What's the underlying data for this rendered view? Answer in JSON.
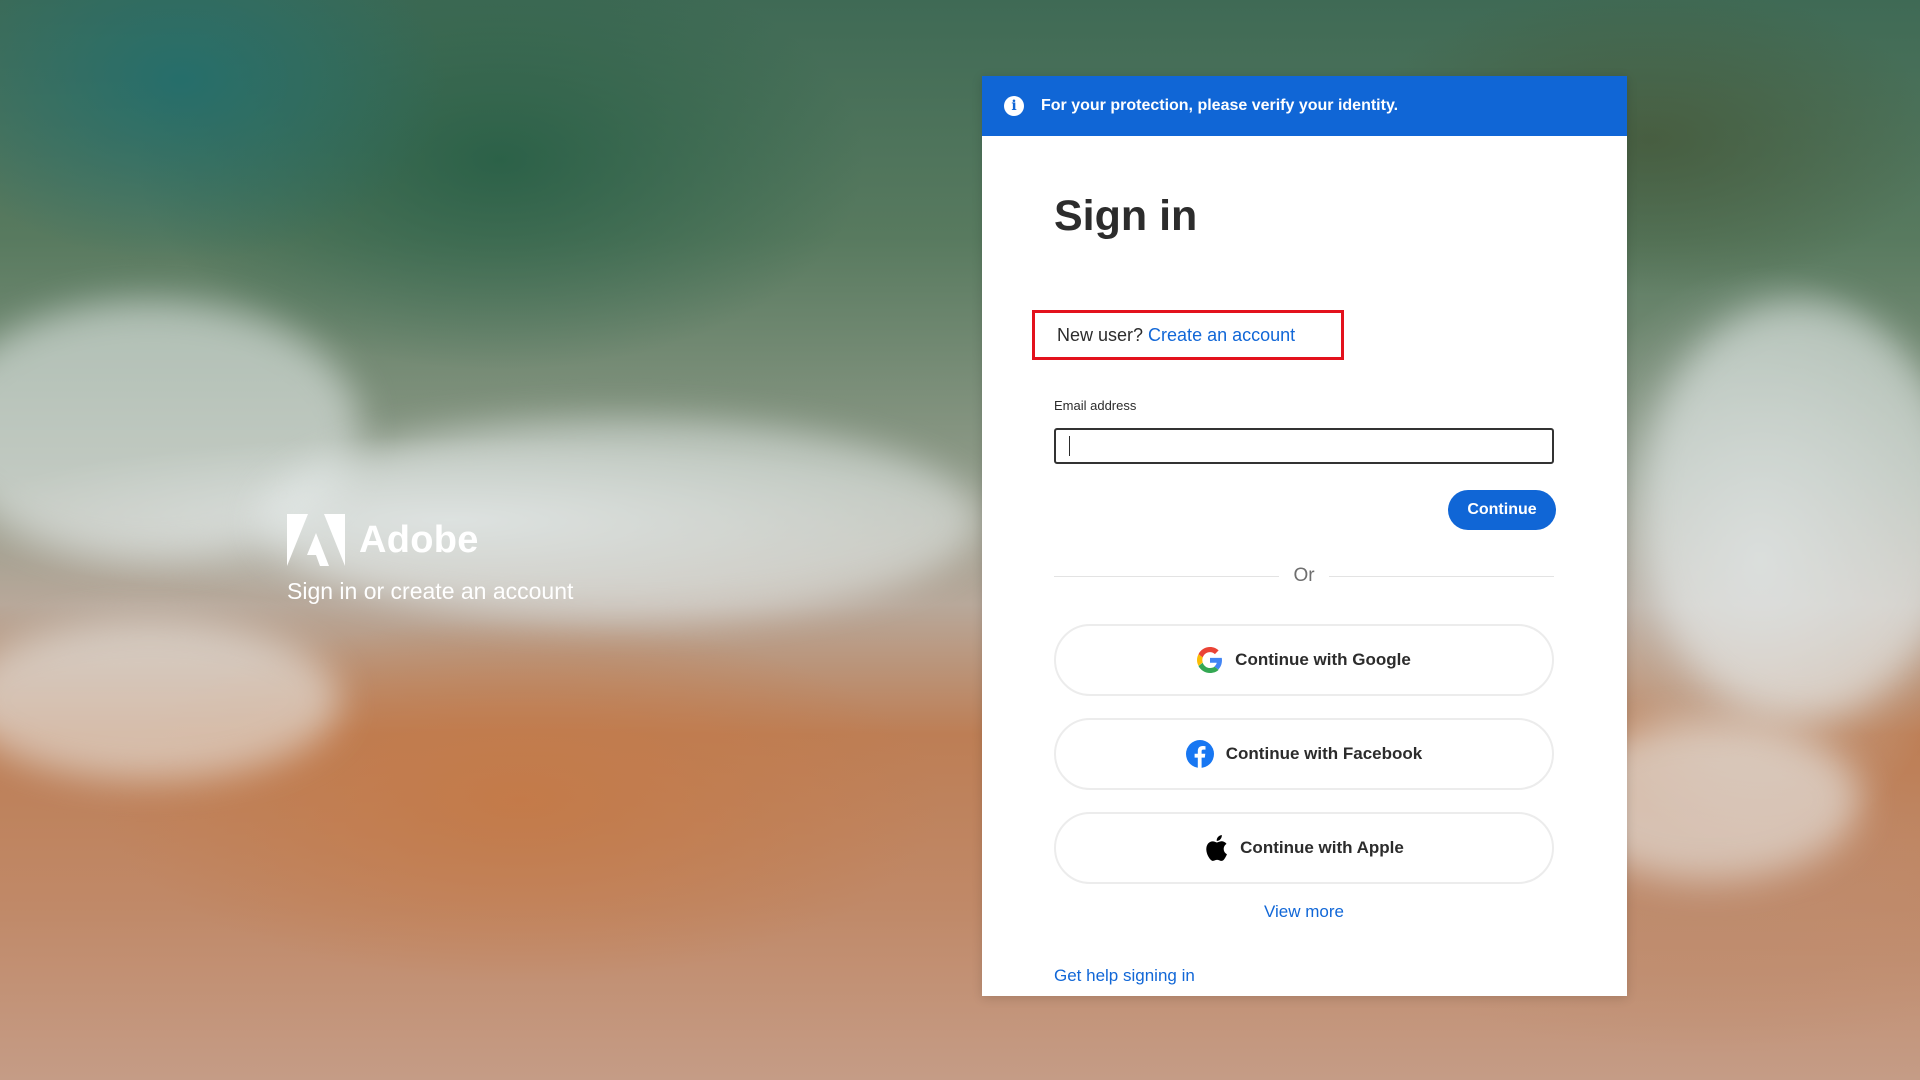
{
  "brand": {
    "name": "Adobe",
    "tagline": "Sign in or create an account"
  },
  "banner": {
    "icon": "info-icon",
    "text": "For your protection, please verify your identity."
  },
  "signin": {
    "title": "Sign in",
    "new_user_prompt": "New user?",
    "create_account_link": "Create an account",
    "email_label": "Email address",
    "email_value": "",
    "continue_label": "Continue",
    "divider_text": "Or",
    "social": {
      "google_label": "Continue with Google",
      "facebook_label": "Continue with Facebook",
      "apple_label": "Continue with Apple"
    },
    "view_more_label": "View more",
    "help_label": "Get help signing in"
  },
  "colors": {
    "accent": "#1066d6",
    "link": "#1167d7",
    "highlight_border": "#e3111c"
  }
}
